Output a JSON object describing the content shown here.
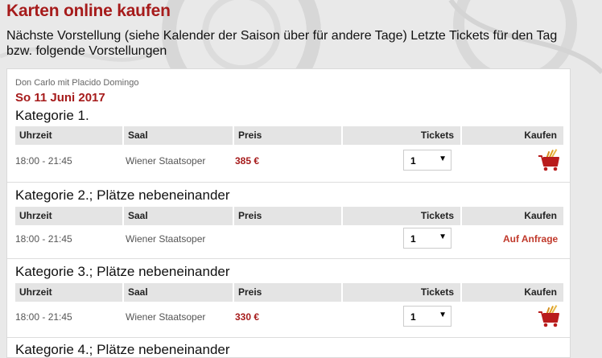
{
  "header": {
    "title": "Karten online kaufen",
    "intro": "Nächste Vorstellung (siehe Kalender der Saison über für andere Tage) Letzte Tickets für den Tag bzw. folgende Vorstellungen"
  },
  "event": {
    "name": "Don Carlo mit Placido Domingo",
    "date": "So 11 Juni 2017"
  },
  "columns": {
    "time": "Uhrzeit",
    "hall": "Saal",
    "price": "Preis",
    "tickets": "Tickets",
    "buy": "Kaufen"
  },
  "categories": [
    {
      "title": "Kategorie 1.",
      "time": "18:00 - 21:45",
      "hall": "Wiener Staatsoper",
      "price": "385 €",
      "tickets": "1",
      "action": "cart-icon"
    },
    {
      "title": "Kategorie 2.; Plätze nebeneinander",
      "time": "18:00 - 21:45",
      "hall": "Wiener Staatsoper",
      "price": "",
      "tickets": "1",
      "action_text": "Auf Anfrage"
    },
    {
      "title": "Kategorie 3.; Plätze nebeneinander",
      "time": "18:00 - 21:45",
      "hall": "Wiener Staatsoper",
      "price": "330 €",
      "tickets": "1",
      "action": "cart-icon"
    },
    {
      "title": "Kategorie 4.; Plätze nebeneinander"
    }
  ],
  "colors": {
    "accent": "#a61b1b",
    "header_bg": "#e4e4e4",
    "page_bg": "#e9e9e9"
  }
}
